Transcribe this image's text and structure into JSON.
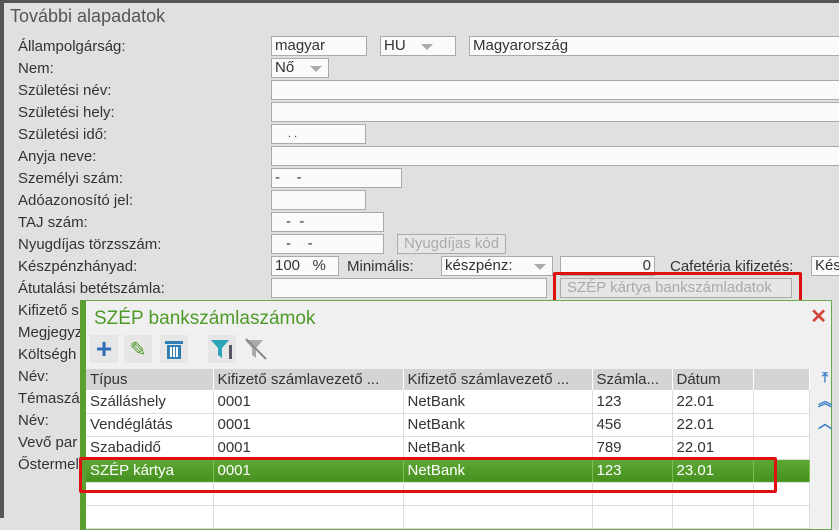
{
  "title": "További alapadatok",
  "labels": [
    "Állampolgárság:",
    "Nem:",
    "Születési név:",
    "Születési hely:",
    "Születési idő:",
    "Anyja neve:",
    "Személyi szám:",
    "Adóazonosító jel:",
    "TAJ szám:",
    "Nyugdíjas törzsszám:",
    "Készpénzhányad:",
    "Átutalási betétszámla:",
    "Kifizető s",
    "Megjegyz",
    "Költségh",
    "Név:",
    "Témaszá",
    "Név:",
    "Vevő par",
    "Őstermel"
  ],
  "fields": {
    "nationality": "magyar",
    "country_code": "HU",
    "country": "Magyarország",
    "gender": "Nő",
    "birth_date": ". .",
    "personal_id": "-    -",
    "taj": "-  -",
    "pension_id": "-    -",
    "cash_pct": "100",
    "pct_sign": "%",
    "minimal_label": "Minimális:",
    "minimal_select": "készpénz:",
    "minimal_value": "0",
    "cafeteria_label": "Cafetéria kifizetés:",
    "cafeteria_value": "Kés"
  },
  "buttons": {
    "pension_code": "Nyugdíjas kód",
    "szep_bank": "SZÉP kártya bankszámladatok"
  },
  "dialog": {
    "title": "SZÉP bankszámlaszámok",
    "close": "✕",
    "columns": [
      "Típus",
      "Kifizető számlavezető ...",
      "Kifizető számlavezető ...",
      "Számla...",
      "Dátum",
      ""
    ],
    "rows": [
      [
        "Szálláshely",
        "0001",
        "NetBank",
        "123",
        "22.01"
      ],
      [
        "Vendéglátás",
        "0001",
        "NetBank",
        "456",
        "22.01"
      ],
      [
        "Szabadidő",
        "0001",
        "NetBank",
        "789",
        "22.01"
      ],
      [
        "SZÉP kártya",
        "0001",
        "NetBank",
        "123",
        "23.01"
      ]
    ],
    "selected_row": 3
  },
  "colors": {
    "accent": "#5b9e32",
    "highlight": "#e01010"
  }
}
